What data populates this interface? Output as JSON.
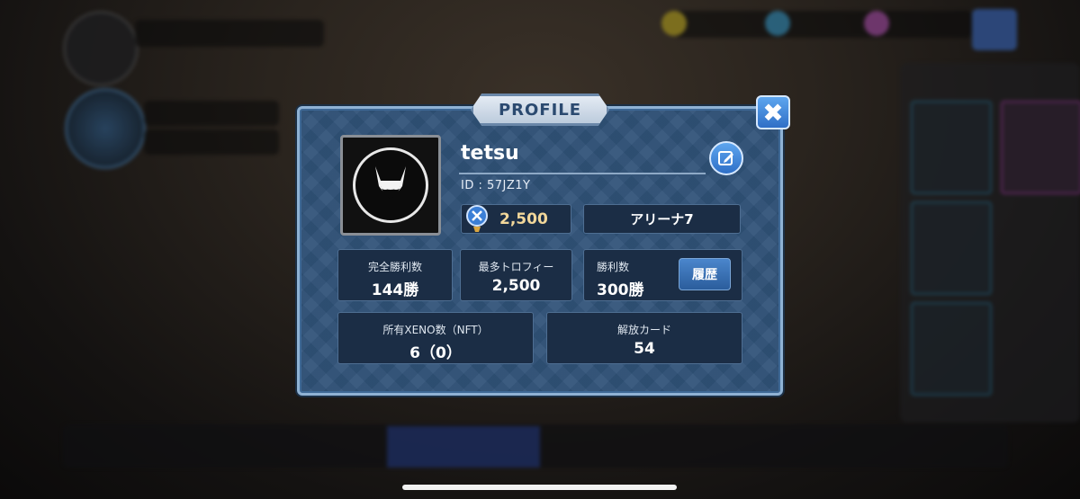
{
  "modal": {
    "title": "PROFILE",
    "close_label": "✖",
    "username": "tetsu",
    "user_id": "ID : 57JZ1Y",
    "trophies": "2,500",
    "arena": "アリーナ7",
    "stats": {
      "perfect_wins_label": "完全勝利数",
      "perfect_wins_value": "144勝",
      "max_trophies_label": "最多トロフィー",
      "max_trophies_value": "2,500",
      "wins_label": "勝利数",
      "wins_value": "300勝",
      "history_button": "履歴",
      "xeno_label": "所有XENO数（NFT）",
      "xeno_value": "6（0）",
      "cards_label": "解放カード",
      "cards_value": "54"
    }
  },
  "icons": {
    "close": "close-icon",
    "edit": "edit-icon",
    "avatar": "cat-mask-avatar-icon",
    "trophy": "trophy-icon"
  },
  "colors": {
    "modal_bg": "#2f5278",
    "accent_blue": "#3a86d9",
    "trophy_gold": "#f2d79a"
  }
}
